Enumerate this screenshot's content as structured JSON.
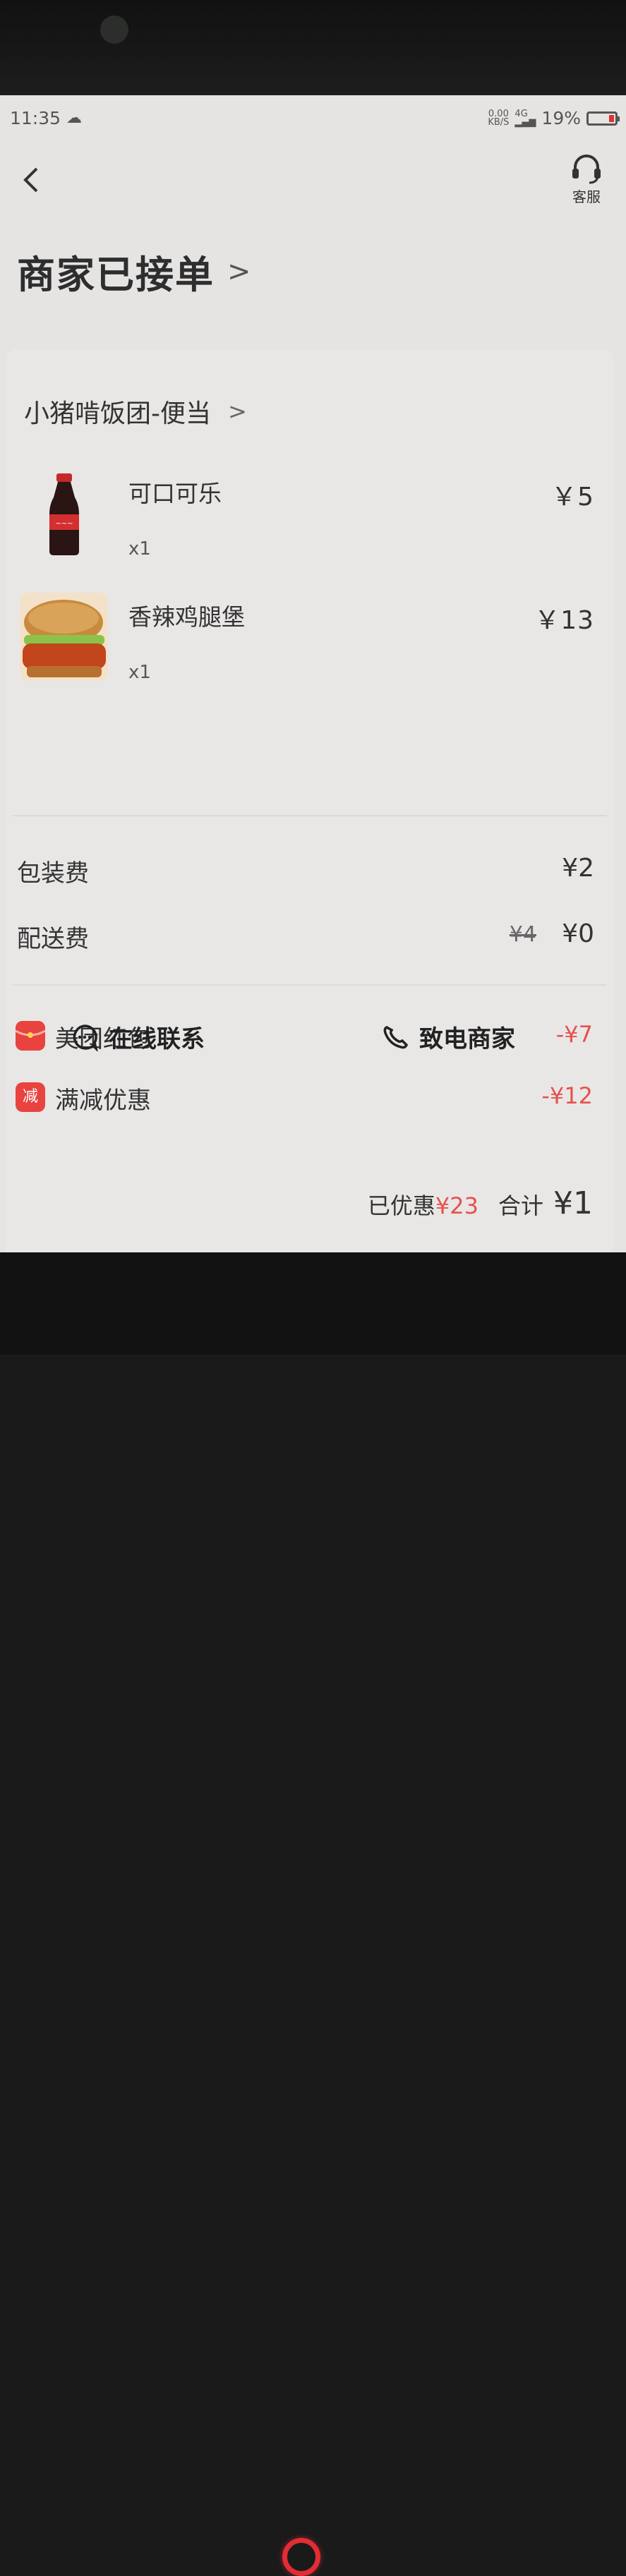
{
  "status_bar": {
    "time": "11:35",
    "net_speed_value": "0.00",
    "net_speed_unit": "KB/S",
    "signal_label": "4G",
    "battery": "19%"
  },
  "header": {
    "back_icon": "chevron-left-icon",
    "service_label": "客服",
    "order_status": "商家已接单"
  },
  "shop": {
    "name": "小猪啃饭团-便当"
  },
  "items": [
    {
      "name": "可口可乐",
      "qty": "x1",
      "price": "￥5",
      "image": "cola-bottle"
    },
    {
      "name": "香辣鸡腿堡",
      "qty": "x1",
      "price": "￥13",
      "image": "chicken-burger"
    }
  ],
  "fees": {
    "packing_label": "包装费",
    "packing_value": "¥2",
    "delivery_label": "配送费",
    "delivery_original": "¥4",
    "delivery_value": "¥0"
  },
  "discounts": {
    "redpacket_label": "美团红包",
    "redpacket_value": "-¥7",
    "fullcut_icon_text": "减",
    "fullcut_label": "满减优惠",
    "fullcut_value": "-¥12"
  },
  "summary": {
    "saved_label": "已优惠",
    "saved_value": "¥23",
    "total_label": "合计",
    "total_value": "¥1"
  },
  "actions": {
    "online_label": "在线联系",
    "call_label": "致电商家"
  },
  "colors": {
    "accent_red": "#e5524e",
    "background": "#e6e4e3"
  }
}
